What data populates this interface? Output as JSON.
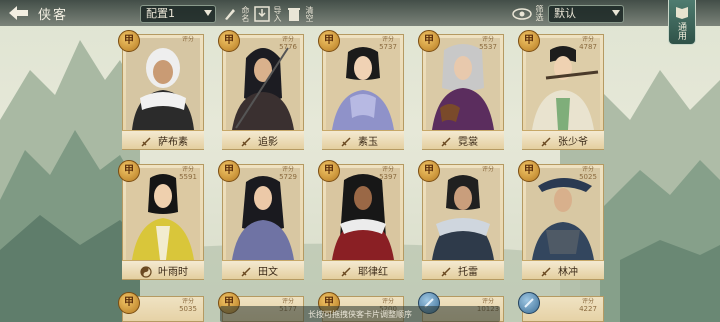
{
  "header": {
    "title": "侠客",
    "preset_value": "配置1",
    "tools": [
      {
        "name": "rename",
        "label": "命名"
      },
      {
        "name": "import",
        "label": "导入"
      },
      {
        "name": "clear",
        "label": "清空"
      }
    ],
    "filter_label": "筛选",
    "sort_value": "默认",
    "use_label": "通用"
  },
  "cards": [
    {
      "name": "萨布素",
      "grade": "甲",
      "score_label": "评分",
      "score": "",
      "class_icon": "weapon-icon"
    },
    {
      "name": "追影",
      "grade": "甲",
      "score_label": "评分",
      "score": "5776",
      "class_icon": "weapon-icon"
    },
    {
      "name": "素玉",
      "grade": "甲",
      "score_label": "评分",
      "score": "5737",
      "class_icon": "weapon-icon"
    },
    {
      "name": "霓裳",
      "grade": "甲",
      "score_label": "评分",
      "score": "5537",
      "class_icon": "weapon-icon"
    },
    {
      "name": "张少爷",
      "grade": "甲",
      "score_label": "评分",
      "score": "4787",
      "class_icon": "weapon-icon"
    },
    {
      "name": "叶雨时",
      "grade": "甲",
      "score_label": "评分",
      "score": "5591",
      "class_icon": "taiji-icon"
    },
    {
      "name": "田文",
      "grade": "甲",
      "score_label": "评分",
      "score": "5729",
      "class_icon": "weapon-icon"
    },
    {
      "name": "耶律红",
      "grade": "甲",
      "score_label": "评分",
      "score": "5397",
      "class_icon": "weapon-icon"
    },
    {
      "name": "托雷",
      "grade": "甲",
      "score_label": "评分",
      "score": "",
      "class_icon": "weapon-icon"
    },
    {
      "name": "林冲",
      "grade": "甲",
      "score_label": "评分",
      "score": "5025",
      "class_icon": "weapon-icon"
    }
  ],
  "partial_cards": [
    {
      "grade": "甲",
      "score": "5035",
      "tone": "gold"
    },
    {
      "grade": "甲",
      "score": "5177",
      "tone": "gold"
    },
    {
      "grade": "甲",
      "score": "5200",
      "tone": "gold"
    },
    {
      "grade": "",
      "score": "10123",
      "tone": "blue"
    },
    {
      "grade": "",
      "score": "4227",
      "tone": "blue"
    }
  ],
  "hint": "长按可拖拽侠客卡片调整顺序"
}
